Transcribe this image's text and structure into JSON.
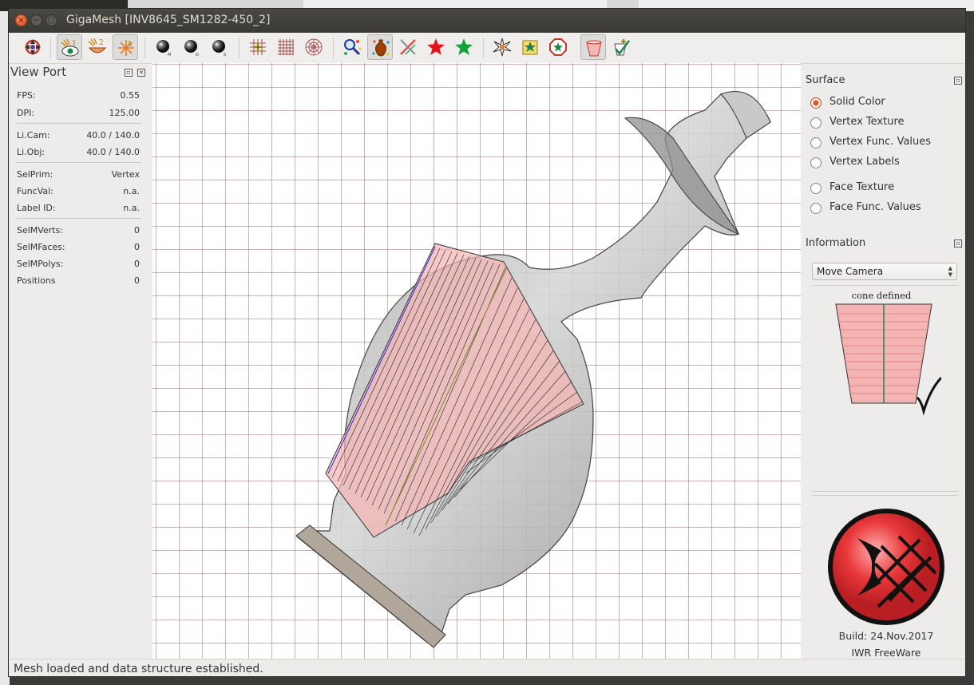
{
  "window": {
    "title": "GigaMesh [INV8645_SM1282-450_2]",
    "close_glyph": "×",
    "minimize_glyph": "−",
    "maximize_glyph": "□"
  },
  "toolbar": {
    "buttons": [
      {
        "name": "reset-view-icon",
        "active": false
      },
      {
        "name": "eye-light-1-icon",
        "active": true
      },
      {
        "name": "bowl-light-2-icon",
        "active": false
      },
      {
        "name": "light-a-icon",
        "active": true
      },
      {
        "name": "sphere-m-icon",
        "active": false
      },
      {
        "name": "sphere-d-icon",
        "active": false
      },
      {
        "name": "sphere-s-icon",
        "active": false
      },
      {
        "name": "grid-plus-icon",
        "active": false
      },
      {
        "name": "grid-icon",
        "active": false
      },
      {
        "name": "polar-grid-icon",
        "active": false
      },
      {
        "name": "magnifier-stars-icon",
        "active": false
      },
      {
        "name": "vase-stars-icon",
        "active": true
      },
      {
        "name": "strike-cross-icon",
        "active": false
      },
      {
        "name": "red-star-icon",
        "active": false
      },
      {
        "name": "green-star-icon",
        "active": false
      },
      {
        "name": "burst-icon",
        "active": false
      },
      {
        "name": "puzzle-star-icon",
        "active": false
      },
      {
        "name": "octagon-star-icon",
        "active": false
      },
      {
        "name": "cone-icon",
        "active": true
      },
      {
        "name": "cone-check-icon",
        "active": false
      }
    ]
  },
  "viewport_panel": {
    "title": "View Port",
    "float_glyph": "▫",
    "close_glyph": "×",
    "stats": [
      {
        "label": "FPS:",
        "value": "0.55"
      },
      {
        "label": "DPI:",
        "value": "125.00"
      },
      {
        "label": "Li.Cam:",
        "value": "40.0 / 140.0"
      },
      {
        "label": "Li.Obj:",
        "value": "40.0 / 140.0"
      },
      {
        "label": "SelPrim:",
        "value": "Vertex"
      },
      {
        "label": "FuncVal:",
        "value": "n.a."
      },
      {
        "label": "Label ID:",
        "value": "n.a."
      },
      {
        "label": "SelMVerts:",
        "value": "0"
      },
      {
        "label": "SelMFaces:",
        "value": "0"
      },
      {
        "label": "SelMPolys:",
        "value": "0"
      },
      {
        "label": "Positions",
        "value": "0"
      }
    ]
  },
  "surface_panel": {
    "title": "Surface",
    "options": [
      {
        "label": "Solid Color",
        "selected": true
      },
      {
        "label": "Vertex Texture",
        "selected": false
      },
      {
        "label": "Vertex Func. Values",
        "selected": false
      },
      {
        "label": "Vertex Labels",
        "selected": false
      },
      {
        "label": "Face Texture",
        "selected": false
      },
      {
        "label": "Face Func. Values",
        "selected": false
      }
    ]
  },
  "information_panel": {
    "title": "Information",
    "mode_select": "Move Camera",
    "cone_caption": "cone defined",
    "build": "Build: 24.Nov.2017",
    "license": "IWR FreeWare"
  },
  "colors": {
    "accent": "#e9541f",
    "cone_fill": "#f4b4b4",
    "grid_line": "#9a6a6a",
    "logo_red": "#e8383a"
  },
  "status_bar": {
    "message": "Mesh loaded and data structure established."
  }
}
